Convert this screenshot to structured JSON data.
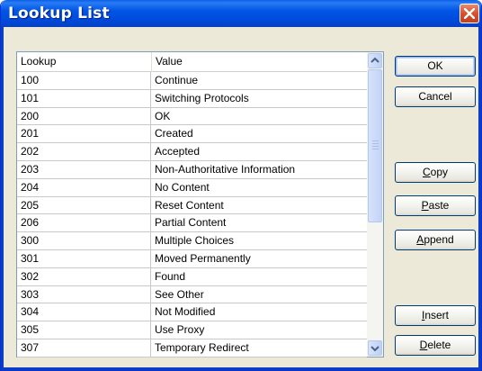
{
  "window": {
    "title": "Lookup List"
  },
  "columns": {
    "lookup": "Lookup",
    "value": "Value"
  },
  "rows": [
    {
      "lookup": "100",
      "value": "Continue"
    },
    {
      "lookup": "101",
      "value": "Switching Protocols"
    },
    {
      "lookup": "200",
      "value": "OK"
    },
    {
      "lookup": "201",
      "value": "Created"
    },
    {
      "lookup": "202",
      "value": "Accepted"
    },
    {
      "lookup": "203",
      "value": "Non-Authoritative Information"
    },
    {
      "lookup": "204",
      "value": "No Content"
    },
    {
      "lookup": "205",
      "value": "Reset Content"
    },
    {
      "lookup": "206",
      "value": "Partial Content"
    },
    {
      "lookup": "300",
      "value": "Multiple Choices"
    },
    {
      "lookup": "301",
      "value": "Moved Permanently"
    },
    {
      "lookup": "302",
      "value": "Found"
    },
    {
      "lookup": "303",
      "value": "See Other"
    },
    {
      "lookup": "304",
      "value": "Not Modified"
    },
    {
      "lookup": "305",
      "value": "Use Proxy"
    },
    {
      "lookup": "307",
      "value": "Temporary Redirect"
    }
  ],
  "buttons": {
    "ok": "OK",
    "cancel": "Cancel",
    "copy": {
      "mnemonic": "C",
      "rest": "opy"
    },
    "paste": {
      "mnemonic": "P",
      "rest": "aste"
    },
    "append": {
      "mnemonic": "A",
      "rest": "ppend"
    },
    "insert": {
      "mnemonic": "I",
      "rest": "nsert"
    },
    "delete": {
      "mnemonic": "D",
      "rest": "elete"
    }
  },
  "icons": {
    "close": "close-icon",
    "scroll_up": "chevron-up-icon",
    "scroll_down": "chevron-down-icon"
  },
  "colors": {
    "titlebar": "#0055e5",
    "close": "#d6512c",
    "dialog_face": "#ece9d8",
    "list_border": "#7f9db9"
  }
}
